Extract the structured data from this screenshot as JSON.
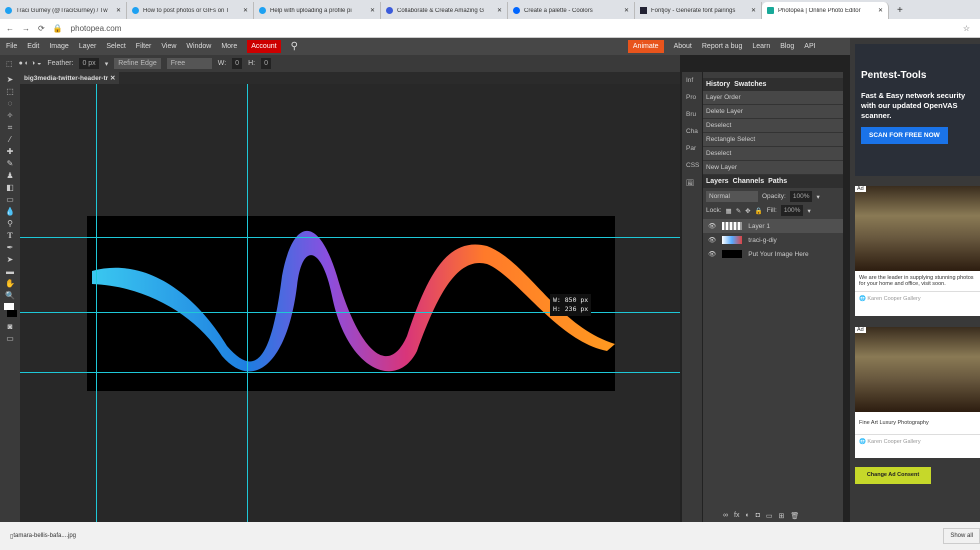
{
  "browser": {
    "tabs": [
      {
        "title": "Traci Gurney (@TraciGurney) / Tw"
      },
      {
        "title": "How to post photos or GIFs on T"
      },
      {
        "title": "Help with uploading a profile pi"
      },
      {
        "title": "Collaborate & Create Amazing G"
      },
      {
        "title": "Create a palette - Coolors"
      },
      {
        "title": "Fontjoy - Generate font pairings"
      },
      {
        "title": "Photopea | Online Photo Editor"
      }
    ],
    "url": "photopea.com"
  },
  "menu": {
    "items": [
      "File",
      "Edit",
      "Image",
      "Layer",
      "Select",
      "Filter",
      "View",
      "Window",
      "More"
    ],
    "account": "Account",
    "animate": "Animate",
    "right": [
      "About",
      "Report a bug",
      "Learn",
      "Blog",
      "API"
    ]
  },
  "options": {
    "feather_label": "Feather:",
    "feather_value": "0 px",
    "refine_edge": "Refine Edge",
    "style": "Free",
    "w_label": "W:",
    "w_value": "0",
    "h_label": "H:",
    "h_value": "0"
  },
  "document": {
    "tab": "big3media-twitter-header-tr"
  },
  "canvas": {
    "size_w": "W: 850 px",
    "size_h": "H: 236 px"
  },
  "side_tabs": [
    "Inf",
    "Pro",
    "Bru",
    "Cha",
    "Par",
    "CSS"
  ],
  "history": {
    "tabs": [
      "History",
      "Swatches"
    ],
    "items": [
      "Layer Order",
      "Delete Layer",
      "Deselect",
      "Rectangle Select",
      "Deselect",
      "New Layer"
    ]
  },
  "layers": {
    "tabs": [
      "Layers",
      "Channels",
      "Paths"
    ],
    "blend": "Normal",
    "opacity_label": "Opacity:",
    "opacity": "100%",
    "lock_label": "Lock:",
    "fill_label": "Fill:",
    "fill": "100%",
    "items": [
      "Layer 1",
      "traci-g-diy",
      "Put Your Image Here"
    ]
  },
  "ads": {
    "brand": "Pentest-Tools",
    "headline": "Fast & Easy network security with our updated OpenVAS scanner.",
    "cta": "SCAN FOR FREE NOW",
    "ad_label": "Ad",
    "card1_text": "We are the leader in supplying stunning photos for your home and office, visit soon.",
    "card1_source": "Karen Cooper Gallery",
    "card2_text": "Fine Art Luxury Photography",
    "card2_source": "Karen Cooper Gallery",
    "consent": "Change Ad Consent"
  },
  "downloads": {
    "file": "tamara-bellis-bafa....jpg",
    "show_all": "Show all"
  }
}
